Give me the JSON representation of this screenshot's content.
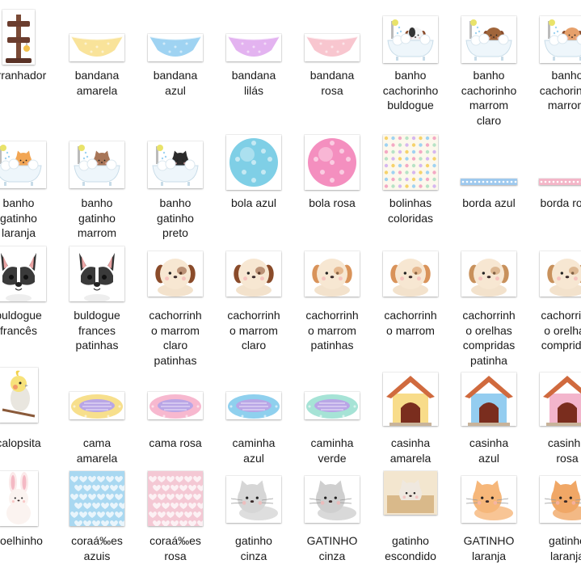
{
  "items": [
    {
      "label": "arranhador",
      "icon": "scratching-post-icon"
    },
    {
      "label": "bandana\namarela",
      "icon": "bandana-icon",
      "color": "#f9e39a"
    },
    {
      "label": "bandana\nazul",
      "icon": "bandana-icon",
      "color": "#9fd3f2"
    },
    {
      "label": "bandana\nlilás",
      "icon": "bandana-icon",
      "color": "#e3b3f0"
    },
    {
      "label": "bandana\nrosa",
      "icon": "bandana-icon",
      "color": "#f8c6cf"
    },
    {
      "label": "banho\ncachorinho\nbuldogue",
      "icon": "bath-pet-icon",
      "color": "#333333"
    },
    {
      "label": "banho\ncachorinho\nmarrom\nclaro",
      "icon": "bath-pet-icon",
      "color": "#a0653a"
    },
    {
      "label": "banho\ncachorinho\nmarrom",
      "icon": "bath-pet-icon",
      "color": "#e6a06b"
    },
    {
      "label": "banho\ngatinho\nlaranja",
      "icon": "bath-pet-icon",
      "color": "#f2a654"
    },
    {
      "label": "banho\ngatinho\nmarrom",
      "icon": "bath-pet-icon",
      "color": "#a87658"
    },
    {
      "label": "banho\ngatinho\npreto",
      "icon": "bath-pet-icon",
      "color": "#2c2c2c"
    },
    {
      "label": "bola azul",
      "icon": "ball-icon",
      "color": "#7fcfe6"
    },
    {
      "label": "bola rosa",
      "icon": "ball-icon",
      "color": "#f48fbf"
    },
    {
      "label": "bolinhas\ncoloridas",
      "icon": "dots-pattern-icon"
    },
    {
      "label": "borda azul",
      "icon": "border-strip-icon",
      "color": "#9ec9ee"
    },
    {
      "label": "borda rosa",
      "icon": "border-strip-icon",
      "color": "#f4b6c8"
    },
    {
      "label": "buldogue\nfrancês",
      "icon": "bulldog-icon"
    },
    {
      "label": "buldogue\nfrances\npatinhas",
      "icon": "bulldog-icon"
    },
    {
      "label": "cachorrinh\no marrom\nclaro\npatinhas",
      "icon": "puppy-icon",
      "color": "#8a4b2a"
    },
    {
      "label": "cachorrinh\no marrom\nclaro",
      "icon": "puppy-icon",
      "color": "#8a4b2a"
    },
    {
      "label": "cachorrinh\no marrom\npatinhas",
      "icon": "puppy-icon",
      "color": "#d9935a"
    },
    {
      "label": "cachorrinh\no marrom",
      "icon": "puppy-icon",
      "color": "#d9935a"
    },
    {
      "label": "cachorrinh\no orelhas\ncompridas\npatinha",
      "icon": "puppy-icon",
      "color": "#c8915c"
    },
    {
      "label": "cachorrinh\no orelhas\ncompridas",
      "icon": "puppy-icon",
      "color": "#c8915c"
    },
    {
      "label": "calopsita",
      "icon": "cockatiel-icon"
    },
    {
      "label": "cama\namarela",
      "icon": "pet-bed-icon",
      "color": "#f7df8c"
    },
    {
      "label": "cama rosa",
      "icon": "pet-bed-icon",
      "color": "#f7b8cf"
    },
    {
      "label": "caminha\nazul",
      "icon": "pet-bed-icon",
      "color": "#8fd0ee"
    },
    {
      "label": "caminha\nverde",
      "icon": "pet-bed-icon",
      "color": "#a6e3d6"
    },
    {
      "label": "casinha\namarela",
      "icon": "doghouse-icon",
      "color": "#f8dc8a"
    },
    {
      "label": "casinha\nazul",
      "icon": "doghouse-icon",
      "color": "#94cdf0"
    },
    {
      "label": "casinha\nrosa",
      "icon": "doghouse-icon",
      "color": "#f3b5cc"
    },
    {
      "label": "coelhinho",
      "icon": "bunny-icon"
    },
    {
      "label": "coraá‰es\nazuis",
      "icon": "hearts-pattern-icon",
      "color": "#a9d8f1"
    },
    {
      "label": "coraá‰es\nrosa",
      "icon": "hearts-pattern-icon",
      "color": "#f4c8d4"
    },
    {
      "label": "gatinho\ncinza",
      "icon": "cat-icon",
      "color": "#d6d6d6"
    },
    {
      "label": "GATINHO\ncinza",
      "icon": "cat-icon",
      "color": "#cfcfcf"
    },
    {
      "label": "gatinho\nescondido",
      "icon": "hidden-cat-icon"
    },
    {
      "label": "GATINHO\nlaranja",
      "icon": "cat-icon",
      "color": "#f6b77a"
    },
    {
      "label": "gatinho\nlaranja",
      "icon": "cat-icon",
      "color": "#f0a766"
    }
  ]
}
